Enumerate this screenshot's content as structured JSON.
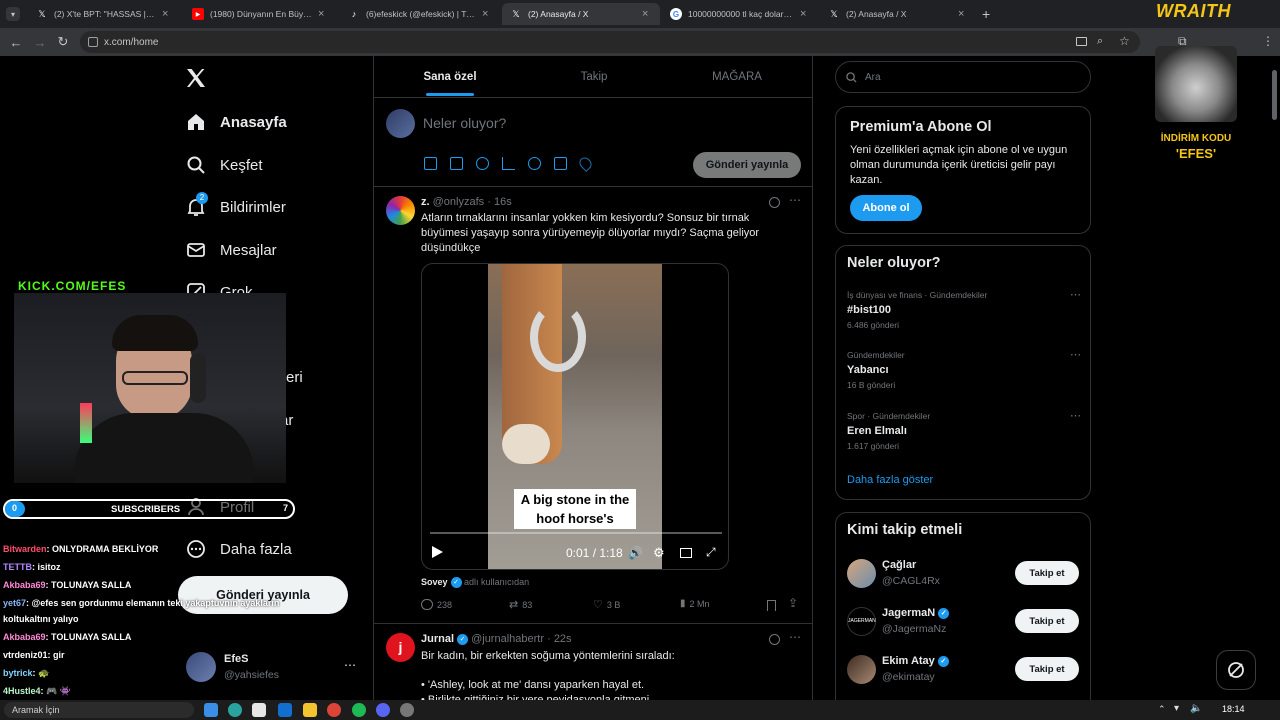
{
  "browser": {
    "tabs": [
      {
        "title": "(2) X'te BPT: \"HASSAS | Şanlıurfa",
        "icon": "x-icon"
      },
      {
        "title": "(1980) Dünyanın En Büyük Yara",
        "icon": "youtube-icon"
      },
      {
        "title": "(6)efeskick (@efeskick) | TikTok",
        "icon": "tiktok-icon"
      },
      {
        "title": "(2) Anasayfa / X",
        "icon": "x-icon"
      },
      {
        "title": "10000000000 tl kaç dolar - Goo",
        "icon": "google-icon"
      },
      {
        "title": "(2) Anasayfa / X",
        "icon": "x-icon"
      }
    ],
    "url": "x.com/home"
  },
  "nav": {
    "items": [
      "Anasayfa",
      "Keşfet",
      "Bildirimler",
      "Mesajlar",
      "Grok",
      "Profil",
      "Daha fazla"
    ],
    "partial": [
      "eri",
      "ar"
    ],
    "notification_count": "2",
    "post_button": "Gönderi yayınla",
    "account": {
      "name": "EfeS",
      "handle": "@yahsiefes"
    }
  },
  "feed": {
    "tabs": [
      "Sana özel",
      "Takip",
      "MAĞARA"
    ],
    "composer": {
      "placeholder": "Neler oluyor?",
      "button": "Gönderi yayınla"
    },
    "tweets": [
      {
        "name": "z.",
        "handle": "@onlyzafs",
        "time": "16s",
        "text": "Atların tırnaklarını insanlar yokken kim kesiyordu? Sonsuz bir tırnak büyümesi yaşayıp sonra yürüyemeyip ölüyorlar mıydı? Saçma geliyor düşündükçe",
        "video_caption_1": "A big stone in the",
        "video_caption_2": "hoof horse's",
        "video_time": "0:01 / 1:18",
        "source_name": "Sovey",
        "source_label": "adlı kullanıcıdan",
        "replies": "238",
        "reposts": "83",
        "likes": "3 B",
        "views": "2 Mn"
      },
      {
        "name": "Jurnal",
        "handle": "@jurnalhabertr",
        "time": "22s",
        "text_1": "Bir kadın, bir erkekten soğuma yöntemlerini sıraladı:",
        "text_2": "• 'Ashley, look at me' dansı yaparken hayal et.",
        "text_3": "• Birlikte gittiğiniz bir yere peyidasyonla gitmeni..."
      }
    ]
  },
  "sidebar": {
    "search_placeholder": "Ara",
    "premium": {
      "title": "Premium'a Abone Ol",
      "body": "Yeni özellikleri açmak için abone ol ve uygun olman durumunda içerik üreticisi gelir payı kazan.",
      "button": "Abone ol"
    },
    "trends": {
      "title": "Neler oluyor?",
      "items": [
        {
          "meta": "İş dünyası ve finans · Gündemdekiler",
          "name": "#bist100",
          "count": "6.486 gönderi"
        },
        {
          "meta": "Gündemdekiler",
          "name": "Yabancı",
          "count": "16 B gönderi"
        },
        {
          "meta": "Spor · Gündemdekiler",
          "name": "Eren Elmalı",
          "count": "1.617 gönderi"
        }
      ],
      "more": "Daha fazla göster"
    },
    "who_to_follow": {
      "title": "Kimi takip etmeli",
      "users": [
        {
          "name": "Çağlar",
          "handle": "@CAGL4Rx",
          "verified": false
        },
        {
          "name": "JagermaN",
          "handle": "@JagermaNz",
          "verified": true
        },
        {
          "name": "Ekim Atay",
          "handle": "@ekimatay",
          "verified": true
        }
      ],
      "button": "Takip et"
    }
  },
  "overlay": {
    "kick": "KICK.COM/EFES",
    "subs_label": "SUBSCRIBERS",
    "subs_left": "0",
    "subs_right": "7",
    "wraith": "WRAITH",
    "promo_1": "İNDİRİM KODU",
    "promo_2": "'EFES'",
    "chat": [
      {
        "user": "Bitwarden",
        "msg": ": ONLYDRAMA BEKLİYOR",
        "color": "#ff4d6d"
      },
      {
        "user": "TETTB",
        "msg": ": isitoz",
        "color": "#b388ff"
      },
      {
        "user": "Akbaba69",
        "msg": ": TOLUNAYA SALLA",
        "color": "#ff8ad8"
      },
      {
        "user": "yet67",
        "msg": ": @efes sen gordunmu elemanın teki yakaptuvnın ayakların",
        "color": "#8ab4f8"
      },
      {
        "user": "",
        "msg": "koltukaltını yalıyo",
        "color": "#fff"
      },
      {
        "user": "Akbaba69",
        "msg": ": TOLUNAYA SALLA",
        "color": "#ff8ad8"
      },
      {
        "user": "vtrdeniz01",
        "msg": ": gir",
        "color": "#ffffff"
      },
      {
        "user": "bytrick",
        "msg": ": 🐢",
        "color": "#80d8ff"
      },
      {
        "user": "4Hustle4",
        "msg": ": 🎮 👾",
        "color": "#b9f6ca"
      }
    ]
  },
  "taskbar": {
    "search": "Aramak İçin",
    "time": "18:14"
  }
}
